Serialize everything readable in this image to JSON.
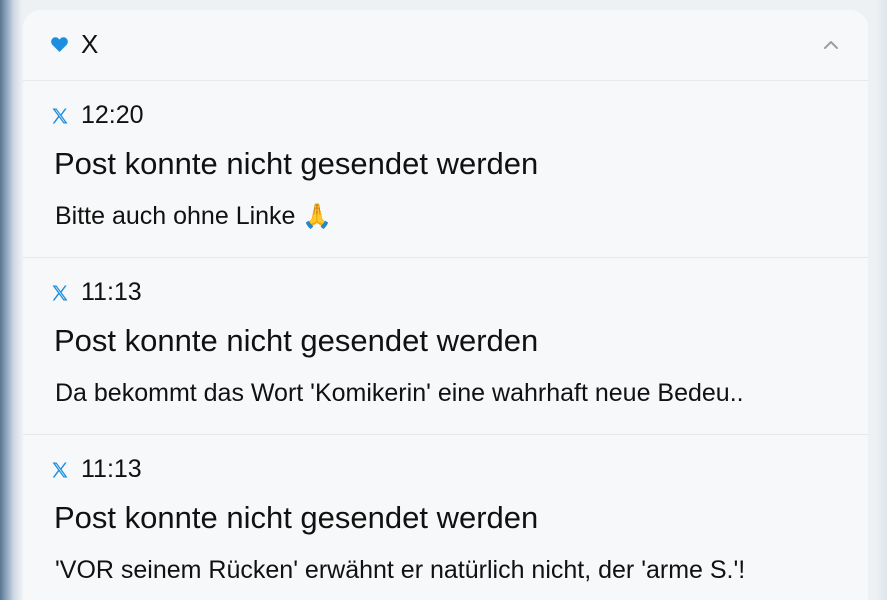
{
  "group": {
    "app_name": "X",
    "accent_color": "#1d8de0"
  },
  "notifications": [
    {
      "time": "12:20",
      "title": "Post konnte nicht gesendet werden",
      "body": "Bitte auch ohne Linke",
      "emoji": "🙏"
    },
    {
      "time": "11:13",
      "title": "Post konnte nicht gesendet werden",
      "body": "Da bekommt das Wort 'Komikerin' eine wahrhaft neue Bedeu.."
    },
    {
      "time": "11:13",
      "title": "Post konnte nicht gesendet werden",
      "body": "'VOR seinem Rücken' erwähnt er natürlich nicht, der 'arme S.'!"
    }
  ]
}
